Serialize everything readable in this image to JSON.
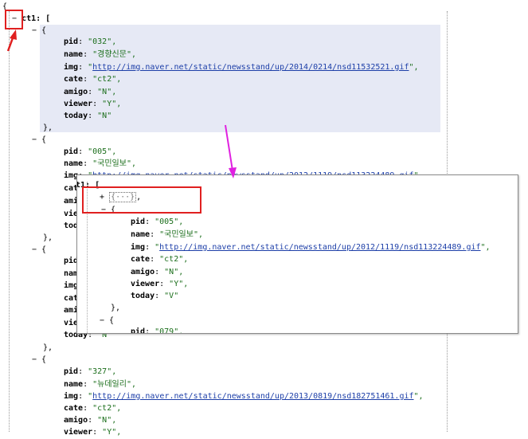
{
  "open_brace": "{",
  "root_key": "ct1",
  "toggle_minus": "−",
  "toggle_plus": "+",
  "collapsed_label": "{···}",
  "items": [
    {
      "pid": "\"032\",",
      "name": "\"경향신문\",",
      "img": "http://img.naver.net/static/newsstand/up/2014/0214/nsd11532521.gif",
      "cate": "\"ct2\",",
      "amigo": "\"N\",",
      "viewer": "\"Y\",",
      "today": "\"N\""
    },
    {
      "pid": "\"005\",",
      "name": "\"국민일보\",",
      "img": "http://img.naver.net/static/newsstand/up/2012/1119/nsd113224489.gif",
      "cate": "\"ct2\",",
      "amigo": "\"N\",",
      "viewer": "\"Y\",",
      "today": "\"V\""
    },
    {
      "pid": "\"079\","
    },
    {
      "pid": "\"327\",",
      "name": "\"뉴데일리\",",
      "img": "http://img.naver.net/static/newsstand/up/2013/0819/nsd182751461.gif",
      "cate": "\"ct2\",",
      "amigo": "\"N\",",
      "viewer": "\"Y\","
    }
  ],
  "colors": {
    "highlight": "#e6e9f5",
    "annotation_red": "#e02020",
    "annotation_magenta": "#e020e0",
    "string_green": "#1b6e1b",
    "link_blue": "#1d3fa8"
  }
}
